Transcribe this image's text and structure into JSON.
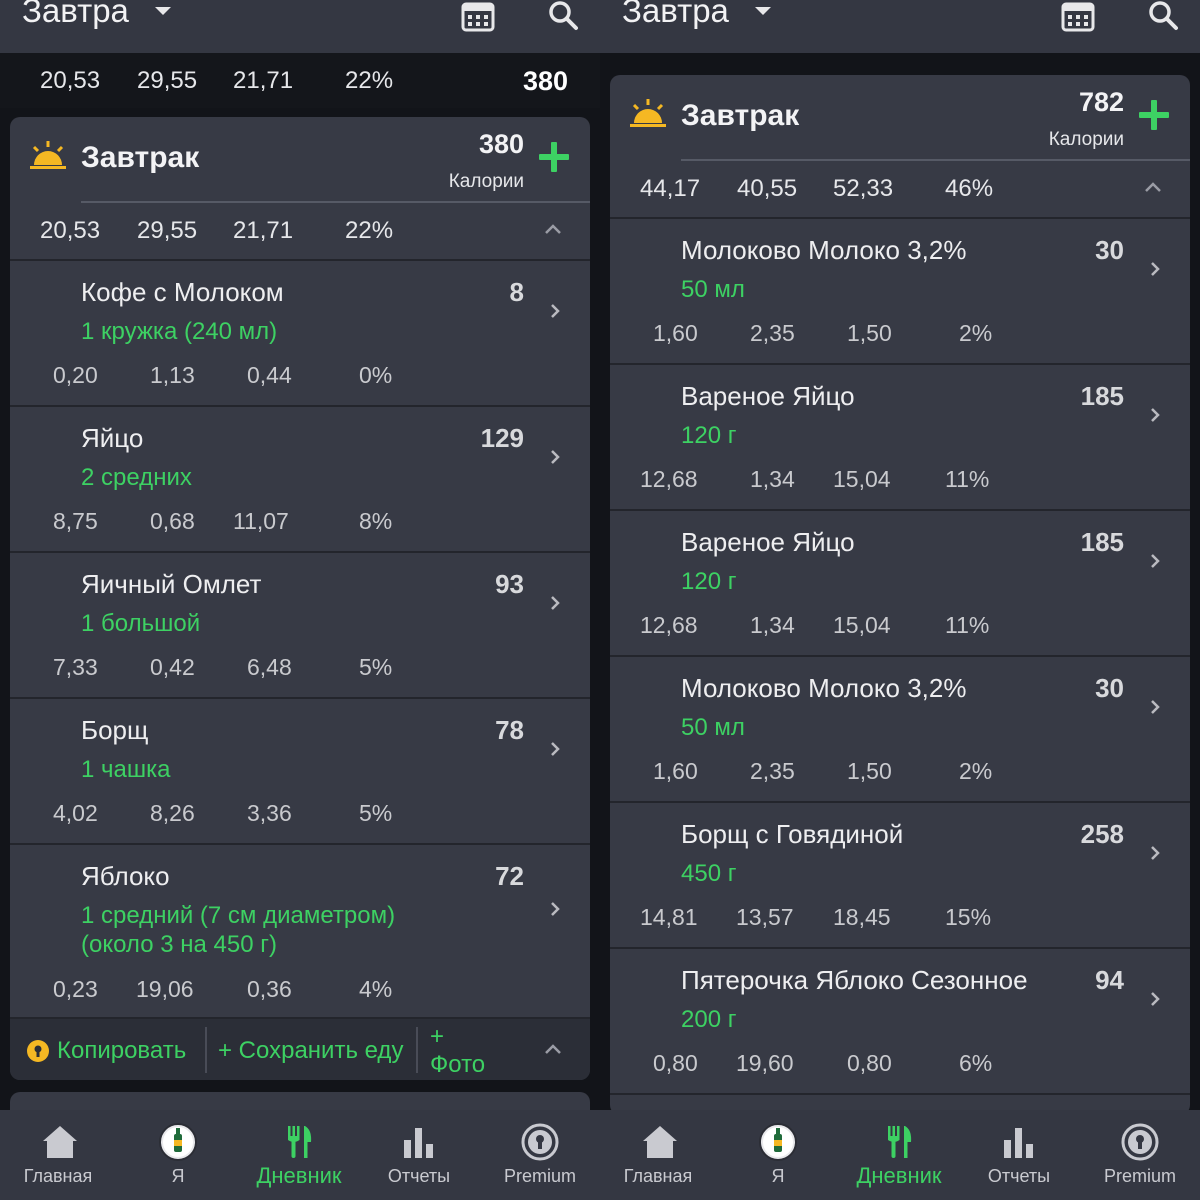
{
  "colors": {
    "accent": "#3dd163",
    "card": "#373a45",
    "appbar": "#343742",
    "background": "#121419",
    "sun": "#f5b823"
  },
  "left": {
    "appbar": {
      "title": "Завтра",
      "icons": [
        "caret-down-icon",
        "calendar-icon",
        "search-icon"
      ]
    },
    "summary": {
      "v1": "20,53",
      "v2": "29,55",
      "v3": "21,71",
      "pct": "22%",
      "cal": "380"
    },
    "meal": {
      "title": "Завтрак",
      "calories": "380",
      "calories_label": "Калории",
      "macros": {
        "v1": "20,53",
        "v2": "29,55",
        "v3": "21,71",
        "pct": "22%"
      },
      "items": [
        {
          "name": "Кофе с Молоком",
          "kcal": "8",
          "portion": "1 кружка (240 мл)",
          "v1": "0,20",
          "v2": "1,13",
          "v3": "0,44",
          "pct": "0%"
        },
        {
          "name": "Яйцо",
          "kcal": "129",
          "portion": "2 средних",
          "v1": "8,75",
          "v2": "0,68",
          "v3": "11,07",
          "pct": "8%"
        },
        {
          "name": "Яичный Омлет",
          "kcal": "93",
          "portion": "1 большой",
          "v1": "7,33",
          "v2": "0,42",
          "v3": "6,48",
          "pct": "5%"
        },
        {
          "name": "Борщ",
          "kcal": "78",
          "portion": "1 чашка",
          "v1": "4,02",
          "v2": "8,26",
          "v3": "3,36",
          "pct": "5%"
        },
        {
          "name": "Яблоко",
          "kcal": "72",
          "portion": "1 средний (7 см диаметром)",
          "portion2": "(около 3 на 450 г)",
          "v1": "0,23",
          "v2": "19,06",
          "v3": "0,36",
          "pct": "4%"
        }
      ],
      "actions": {
        "copy": "Копировать",
        "save": "+ Сохранить еду",
        "photo_plus": "+",
        "photo": "Фото"
      }
    },
    "nav": [
      "Главная",
      "Я",
      "Дневник",
      "Отчеты",
      "Premium"
    ]
  },
  "right": {
    "appbar": {
      "title": "Завтра",
      "icons": [
        "caret-down-icon",
        "calendar-icon",
        "search-icon"
      ]
    },
    "meal": {
      "title": "Завтрак",
      "calories": "782",
      "calories_label": "Калории",
      "macros": {
        "v1": "44,17",
        "v2": "40,55",
        "v3": "52,33",
        "pct": "46%"
      },
      "items": [
        {
          "name": "Молоково Молоко 3,2%",
          "kcal": "30",
          "portion": "50 мл",
          "v1": "1,60",
          "v2": "2,35",
          "v3": "1,50",
          "pct": "2%"
        },
        {
          "name": "Вареное Яйцо",
          "kcal": "185",
          "portion": "120 г",
          "v1": "12,68",
          "v2": "1,34",
          "v3": "15,04",
          "pct": "11%"
        },
        {
          "name": "Вареное Яйцо",
          "kcal": "185",
          "portion": "120 г",
          "v1": "12,68",
          "v2": "1,34",
          "v3": "15,04",
          "pct": "11%"
        },
        {
          "name": "Молоково Молоко 3,2%",
          "kcal": "30",
          "portion": "50 мл",
          "v1": "1,60",
          "v2": "2,35",
          "v3": "1,50",
          "pct": "2%"
        },
        {
          "name": "Борщ с Говядиной",
          "kcal": "258",
          "portion": "450 г",
          "v1": "14,81",
          "v2": "13,57",
          "v3": "18,45",
          "pct": "15%"
        },
        {
          "name": "Пятерочка Яблоко Сезонное",
          "kcal": "94",
          "portion": "200 г",
          "v1": "0,80",
          "v2": "19,60",
          "v3": "0,80",
          "pct": "6%"
        }
      ]
    },
    "nav": [
      "Главная",
      "Я",
      "Дневник",
      "Отчеты",
      "Premium"
    ]
  }
}
